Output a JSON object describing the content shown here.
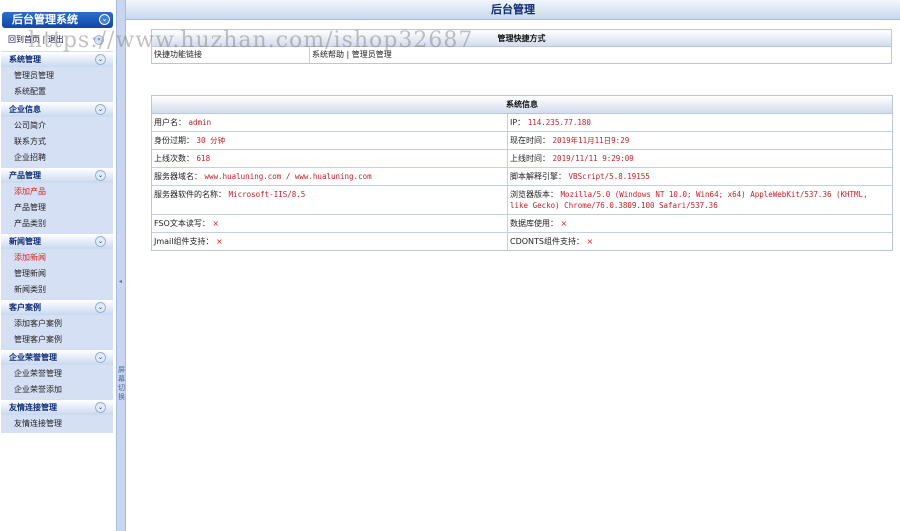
{
  "sidebar": {
    "title": "后台管理系统",
    "title_toggle": "⌄",
    "home_link": "回到首页 | 退出",
    "groups": [
      {
        "title": "系统管理",
        "items": [
          "管理员管理",
          "系统配置"
        ]
      },
      {
        "title": "企业信息",
        "items": [
          "公司简介",
          "联系方式",
          "企业招聘"
        ]
      },
      {
        "title": "产品管理",
        "items": [
          "添加产品",
          "产品管理",
          "产品类别"
        ]
      },
      {
        "title": "新闻管理",
        "items": [
          "添加新闻",
          "管理新闻",
          "新闻类别"
        ]
      },
      {
        "title": "客户案例",
        "items": [
          "添加客户案例",
          "管理客户案例"
        ]
      },
      {
        "title": "企业荣誉管理",
        "items": [
          "企业荣誉管理",
          "企业荣誉添加"
        ]
      },
      {
        "title": "友情连接管理",
        "items": [
          "友情连接管理"
        ]
      }
    ]
  },
  "divider": {
    "arrow": "◂",
    "label": "屏幕切换"
  },
  "header": {
    "title": "后台管理"
  },
  "quick": {
    "title": "管理快捷方式",
    "label": "快捷功能链接",
    "links": "系统帮助 | 管理员管理"
  },
  "info": {
    "title": "系统信息",
    "rows": [
      [
        {
          "label": "用户名：",
          "value": "admin"
        },
        {
          "label": "IP：",
          "value": "114.235.77.180"
        }
      ],
      [
        {
          "label": "身份过期：",
          "value": "30 分钟"
        },
        {
          "label": "现在时间：",
          "value": "2019年11月11日9:29"
        }
      ],
      [
        {
          "label": "上线次数：",
          "value": "618"
        },
        {
          "label": "上线时间：",
          "value": "2019/11/11 9:29:09"
        }
      ],
      [
        {
          "label": "服务器域名：",
          "value": "www.hualuning.com / www.hualuning.com"
        },
        {
          "label": "脚本解释引擎：",
          "value": "VBScript/5.8.19155"
        }
      ],
      [
        {
          "label": "服务器软件的名称：",
          "value": "Microsoft-IIS/8.5"
        },
        {
          "label": "浏览器版本：",
          "value": "Mozilla/5.0 (Windows NT 10.0; Win64; x64) AppleWebKit/537.36 (KHTML, like Gecko) Chrome/76.0.3809.100 Safari/537.36"
        }
      ],
      [
        {
          "label": "FSO文本读写：",
          "value": "×"
        },
        {
          "label": "数据库使用：",
          "value": "×"
        }
      ],
      [
        {
          "label": "Jmail组件支持：",
          "value": "×"
        },
        {
          "label": "CDONTS组件支持：",
          "value": "×"
        }
      ]
    ]
  },
  "watermark": "https://www.huzhan.com/ishop32687",
  "colors": {
    "accent": "#0f46a8",
    "sidebar_item_bg": "#d6e0f5",
    "highlight_red": "#e2211c"
  }
}
